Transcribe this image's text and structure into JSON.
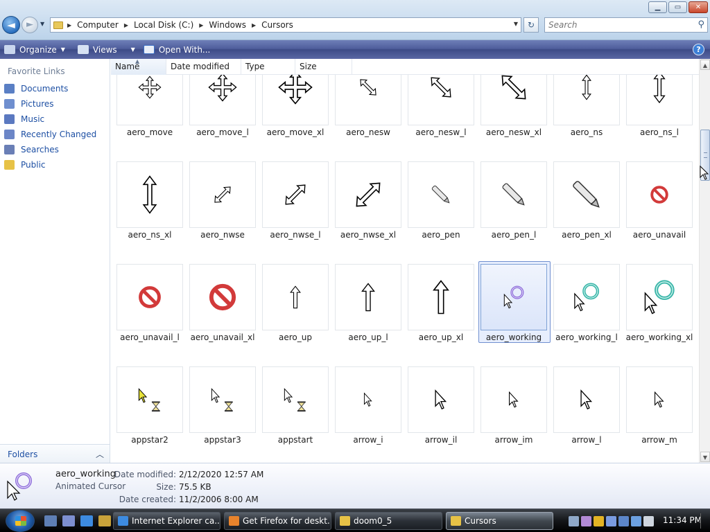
{
  "window": {
    "minimize_glyph": "▁",
    "maximize_glyph": "▭",
    "close_glyph": "✕"
  },
  "nav": {
    "back_glyph": "◄",
    "forward_glyph": "►",
    "history_glyph": "▼",
    "breadcrumbs": [
      "Computer",
      "Local Disk (C:)",
      "Windows",
      "Cursors"
    ],
    "refresh_glyph": "↻",
    "search_placeholder": "Search"
  },
  "toolbar": {
    "organize": "Organize",
    "views": "Views",
    "open_with": "Open With...",
    "help": "?"
  },
  "sidebar": {
    "title": "Favorite Links",
    "items": [
      {
        "label": "Documents",
        "icon": "documents-icon",
        "color": "#5a7fc4"
      },
      {
        "label": "Pictures",
        "icon": "pictures-icon",
        "color": "#6f8fcf"
      },
      {
        "label": "Music",
        "icon": "music-icon",
        "color": "#5b79c0"
      },
      {
        "label": "Recently Changed",
        "icon": "recent-icon",
        "color": "#6c86c7"
      },
      {
        "label": "Searches",
        "icon": "searches-icon",
        "color": "#6a7fb6"
      },
      {
        "label": "Public",
        "icon": "public-folder-icon",
        "color": "#e7c246"
      }
    ],
    "folders_label": "Folders",
    "folders_chevron": "︿"
  },
  "columns": [
    "Name",
    "Date modified",
    "Type",
    "Size"
  ],
  "files": [
    {
      "name": "aero_move",
      "icon": "move-cursor"
    },
    {
      "name": "aero_move_l",
      "icon": "move-cursor"
    },
    {
      "name": "aero_move_xl",
      "icon": "move-cursor"
    },
    {
      "name": "aero_nesw",
      "icon": "resize-nesw-cursor"
    },
    {
      "name": "aero_nesw_l",
      "icon": "resize-nesw-cursor"
    },
    {
      "name": "aero_nesw_xl",
      "icon": "resize-nesw-cursor"
    },
    {
      "name": "aero_ns",
      "icon": "resize-ns-cursor"
    },
    {
      "name": "aero_ns_l",
      "icon": "resize-ns-cursor"
    },
    {
      "name": "aero_ns_xl",
      "icon": "resize-ns-cursor"
    },
    {
      "name": "aero_nwse",
      "icon": "resize-nwse-cursor"
    },
    {
      "name": "aero_nwse_l",
      "icon": "resize-nwse-cursor"
    },
    {
      "name": "aero_nwse_xl",
      "icon": "resize-nwse-cursor"
    },
    {
      "name": "aero_pen",
      "icon": "pen-cursor"
    },
    {
      "name": "aero_pen_l",
      "icon": "pen-cursor"
    },
    {
      "name": "aero_pen_xl",
      "icon": "pen-cursor"
    },
    {
      "name": "aero_unavail",
      "icon": "unavailable-cursor"
    },
    {
      "name": "aero_unavail_l",
      "icon": "unavailable-cursor"
    },
    {
      "name": "aero_unavail_xl",
      "icon": "unavailable-cursor"
    },
    {
      "name": "aero_up",
      "icon": "up-arrow-cursor"
    },
    {
      "name": "aero_up_l",
      "icon": "up-arrow-cursor"
    },
    {
      "name": "aero_up_xl",
      "icon": "up-arrow-cursor"
    },
    {
      "name": "aero_working",
      "icon": "working-cursor",
      "selected": true
    },
    {
      "name": "aero_working_l",
      "icon": "working-cursor"
    },
    {
      "name": "aero_working_xl",
      "icon": "working-cursor"
    },
    {
      "name": "appstar2",
      "icon": "appstarting-cursor"
    },
    {
      "name": "appstar3",
      "icon": "appstarting-cursor"
    },
    {
      "name": "appstart",
      "icon": "appstarting-cursor"
    },
    {
      "name": "arrow_i",
      "icon": "arrow-cursor"
    },
    {
      "name": "arrow_il",
      "icon": "arrow-cursor"
    },
    {
      "name": "arrow_im",
      "icon": "arrow-cursor"
    },
    {
      "name": "arrow_l",
      "icon": "arrow-cursor"
    },
    {
      "name": "arrow_m",
      "icon": "arrow-cursor"
    }
  ],
  "details": {
    "name": "aero_working",
    "type": "Animated Cursor",
    "date_modified_label": "Date modified:",
    "date_modified": "2/12/2020 12:57 AM",
    "size_label": "Size:",
    "size": "75.5 KB",
    "date_created_label": "Date created:",
    "date_created": "11/2/2006 8:00 AM"
  },
  "taskbar": {
    "tasks": [
      {
        "label": "Internet Explorer ca...",
        "icon": "ie-icon",
        "color": "#3d8be0"
      },
      {
        "label": "Get Firefox for deskt...",
        "icon": "firefox-icon",
        "color": "#e8832c"
      },
      {
        "label": "doom0_5",
        "icon": "folder-icon",
        "color": "#e7c246"
      },
      {
        "label": "Cursors",
        "icon": "folder-icon",
        "color": "#e7c246",
        "active": true
      }
    ],
    "quicklaunch": [
      {
        "icon": "show-desktop-icon",
        "color": "#5e7fb5"
      },
      {
        "icon": "switch-windows-icon",
        "color": "#7d8fd0"
      },
      {
        "icon": "internet-explorer-icon",
        "color": "#3d8be0"
      },
      {
        "icon": "media-icon",
        "color": "#c8a23a"
      }
    ],
    "tray_icons": [
      {
        "icon": "tray-icon-1",
        "color": "#8fa8c8"
      },
      {
        "icon": "tray-icon-2",
        "color": "#b28ad6"
      },
      {
        "icon": "security-shield-icon",
        "color": "#e3b324"
      },
      {
        "icon": "tray-icon-4",
        "color": "#7a9be0"
      },
      {
        "icon": "tray-icon-5",
        "color": "#5c86c9"
      },
      {
        "icon": "network-icon",
        "color": "#6ca0e0"
      },
      {
        "icon": "volume-icon",
        "color": "#cfd6df"
      }
    ],
    "clock": "11:34 PM"
  }
}
